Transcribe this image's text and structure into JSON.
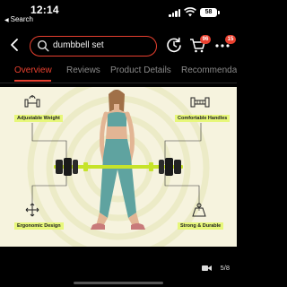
{
  "status_bar": {
    "time": "12:14",
    "back_app": "Search",
    "battery": "58"
  },
  "header": {
    "search_query": "dumbbell set",
    "cart_badge": "96",
    "menu_badge": "15"
  },
  "tabs": [
    {
      "label": "Overview",
      "active": true
    },
    {
      "label": "Reviews",
      "active": false
    },
    {
      "label": "Product Details",
      "active": false
    },
    {
      "label": "Recommendations",
      "active": false
    }
  ],
  "product_image": {
    "features": [
      {
        "label": "Adjustable Weight",
        "icon": "adjustable-dumbbell-icon"
      },
      {
        "label": "Comfortable Handles",
        "icon": "handle-icon"
      },
      {
        "label": "Ergonomic Design",
        "icon": "expand-arrows-icon"
      },
      {
        "label": "Strong & Durable",
        "icon": "weight-icon"
      }
    ],
    "colors": {
      "highlight": "#e7f77a",
      "outfit": "#5fa3a0",
      "bar": "#c6e32a"
    }
  },
  "gallery": {
    "counter": "5/8"
  },
  "colors": {
    "accent": "#e8402f",
    "background": "#000000",
    "hero_bg": "#f6f3de"
  }
}
